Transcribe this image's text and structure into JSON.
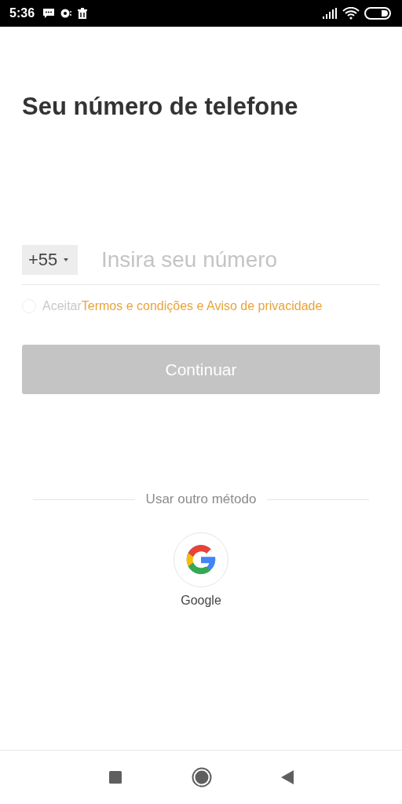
{
  "status_bar": {
    "time": "5:36"
  },
  "title": "Seu número de telefone",
  "phone": {
    "country_code": "+55",
    "placeholder": "Insira seu número"
  },
  "terms": {
    "checked": false,
    "prefix": "Aceitar",
    "link": "Termos e condições e Aviso de privacidade"
  },
  "continue_button": {
    "label": "Continuar",
    "disabled": true
  },
  "alt_methods": {
    "label": "Usar outro método",
    "options": [
      {
        "label": "Google"
      }
    ]
  }
}
